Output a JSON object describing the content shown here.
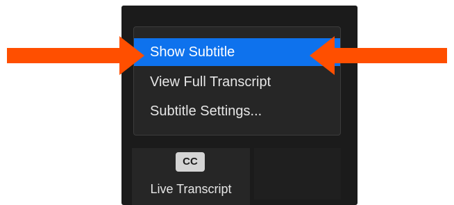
{
  "menu": {
    "items": [
      {
        "label": "Show Subtitle",
        "selected": true
      },
      {
        "label": "View Full Transcript",
        "selected": false
      },
      {
        "label": "Subtitle Settings...",
        "selected": false
      }
    ]
  },
  "toolbar": {
    "live_transcript": {
      "icon": "cc-icon",
      "icon_text": "CC",
      "label": "Live Transcript"
    }
  },
  "colors": {
    "panel_bg": "#1b1b1b",
    "menu_bg": "#262626",
    "selected_bg": "#0e72ed",
    "arrow": "#ff4f00"
  }
}
